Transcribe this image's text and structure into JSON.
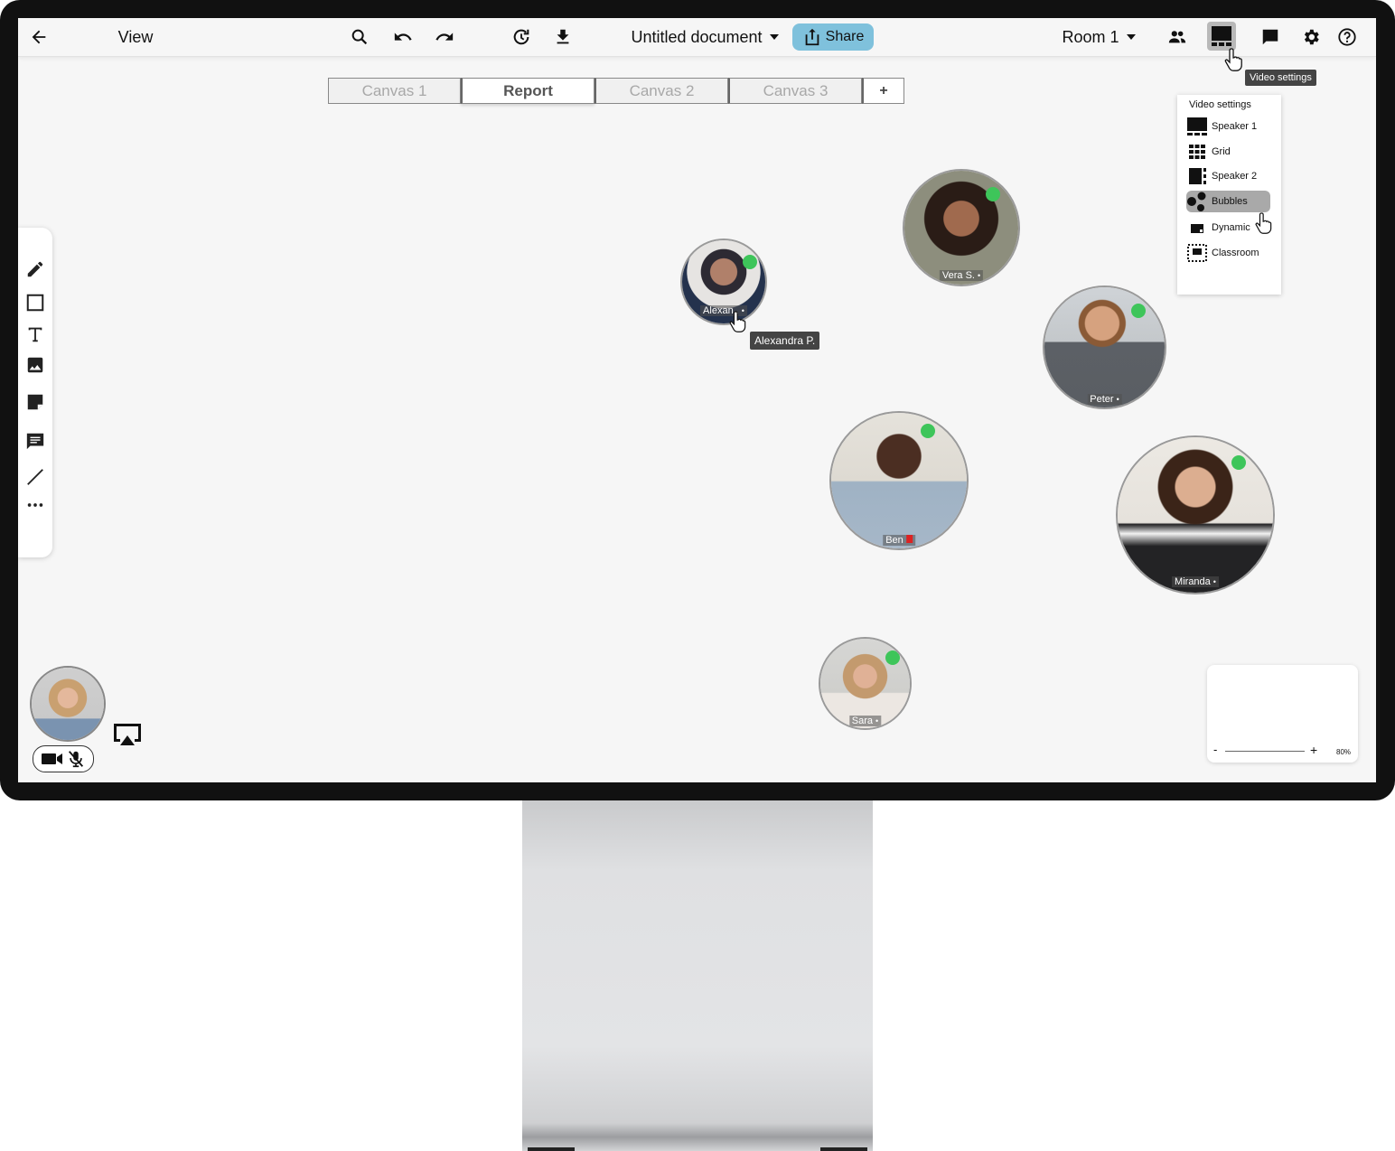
{
  "toolbar": {
    "back_icon": "arrow-left-icon",
    "view_label": "View",
    "tools": [
      "search-icon",
      "undo-icon",
      "redo-icon",
      "history-icon",
      "download-icon"
    ],
    "document_title": "Untitled document",
    "share_label": "Share",
    "room_label": "Room 1",
    "right_icons": [
      "people-icon",
      "video-layout-icon",
      "chat-icon",
      "gear-icon",
      "help-icon"
    ]
  },
  "tooltips": {
    "video_settings": "Video settings",
    "participant_hover": "Alexandra P."
  },
  "tabs": [
    {
      "label": "Canvas 1",
      "active": false
    },
    {
      "label": "Report",
      "active": true
    },
    {
      "label": "Canvas 2",
      "active": false
    },
    {
      "label": "Canvas 3",
      "active": false
    }
  ],
  "add_tab_label": "+",
  "palette_tools": [
    "pencil-icon",
    "rectangle-icon",
    "text-icon",
    "image-icon",
    "sticky-note-icon",
    "comment-icon",
    "line-icon",
    "more-icon"
  ],
  "video_menu": {
    "title": "Video settings",
    "items": [
      {
        "label": "Speaker 1",
        "icon": "speaker1-layout-icon"
      },
      {
        "label": "Grid",
        "icon": "grid-layout-icon"
      },
      {
        "label": "Speaker 2",
        "icon": "speaker2-layout-icon"
      },
      {
        "label": "Bubbles",
        "icon": "bubbles-layout-icon",
        "selected": true
      },
      {
        "label": "Dynamic",
        "icon": "dynamic-layout-icon"
      },
      {
        "label": "Classroom",
        "icon": "classroom-layout-icon"
      }
    ]
  },
  "participants": [
    {
      "name": "Alexan..",
      "mic": "on",
      "online": true
    },
    {
      "name": "Vera S.",
      "mic": "on",
      "online": true
    },
    {
      "name": "Peter",
      "mic": "on",
      "online": true
    },
    {
      "name": "Ben",
      "mic": "muted",
      "online": true
    },
    {
      "name": "Miranda",
      "mic": "on",
      "online": true
    },
    {
      "name": "Sara",
      "mic": "on",
      "online": true
    }
  ],
  "zoom": {
    "minus": "-",
    "plus": "+",
    "level": "80%"
  },
  "colors": {
    "share": "#7fc1dc",
    "online_dot": "#3ec55a",
    "selected_menu": "#a9a9a9"
  }
}
